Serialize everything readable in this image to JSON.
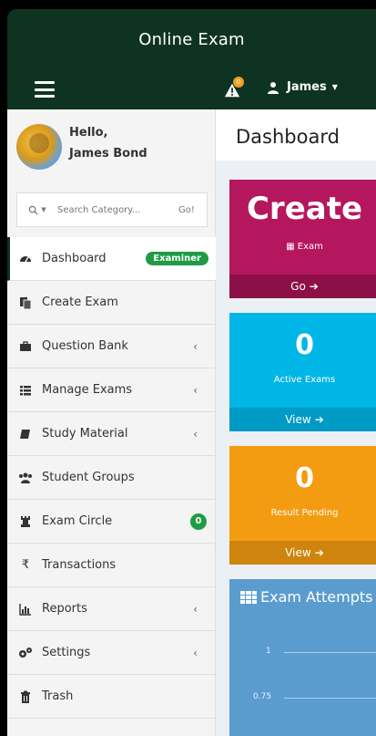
{
  "header": {
    "title": "Online Exam",
    "alert_count": "0",
    "user_name": "James"
  },
  "sidebar": {
    "greeting": "Hello,",
    "full_name": "James Bond",
    "search": {
      "placeholder": "Search Category...",
      "go_label": "Go!"
    },
    "items": [
      {
        "label": "Dashboard",
        "badge": "Examiner"
      },
      {
        "label": "Create Exam"
      },
      {
        "label": "Question Bank"
      },
      {
        "label": "Manage Exams"
      },
      {
        "label": "Study Material"
      },
      {
        "label": "Student Groups"
      },
      {
        "label": "Exam Circle",
        "badge": "0"
      },
      {
        "label": "Transactions"
      },
      {
        "label": "Reports"
      },
      {
        "label": "Settings"
      },
      {
        "label": "Trash"
      }
    ]
  },
  "main": {
    "page_title": "Dashboard",
    "create_card": {
      "title": "Create",
      "subtitle": "Exam",
      "footer": "Go"
    },
    "active_card": {
      "value": "0",
      "label": "Active Exams",
      "footer": "View"
    },
    "pending_card": {
      "value": "0",
      "label": "Result Pending",
      "footer": "View"
    },
    "attempts_card": {
      "title": "Exam Attempts",
      "ticks": [
        "1",
        "0.75"
      ]
    }
  },
  "colors": {
    "header_bg": "#0f3322",
    "create": "#b5175e",
    "active": "#00b6e6",
    "pending": "#f39c12",
    "attempts": "#5b9ccf",
    "badge_green": "#1f9b46"
  }
}
